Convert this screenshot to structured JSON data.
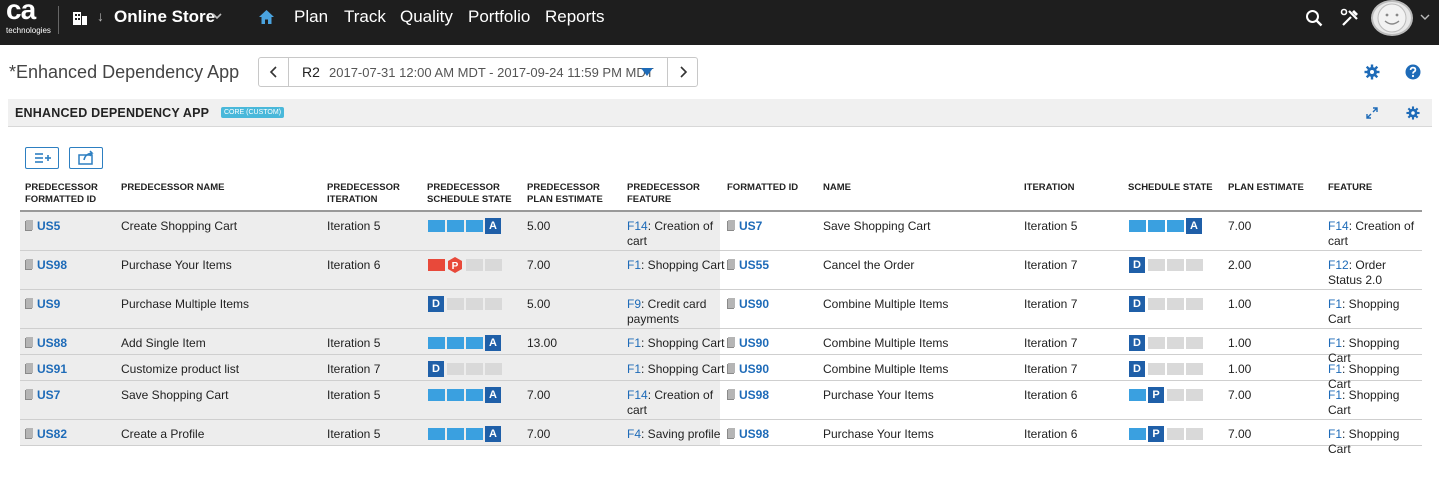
{
  "nav": {
    "logo_text": "ca",
    "logo_sub": "technologies",
    "workspace": "Online Store",
    "items": [
      "Plan",
      "Track",
      "Quality",
      "Portfolio",
      "Reports"
    ]
  },
  "app": {
    "title": "*Enhanced Dependency App",
    "release_name": "R2",
    "release_dates": "2017-07-31 12:00 AM MDT - 2017-09-24 11:59 PM MDT"
  },
  "panel": {
    "title": "ENHANCED DEPENDENCY APP",
    "badge": "CORE (CUSTOM)"
  },
  "columns": [
    [
      "PREDECESSOR",
      "FORMATTED ID"
    ],
    [
      "PREDECESSOR NAME"
    ],
    [
      "PREDECESSOR",
      "ITERATION"
    ],
    [
      "PREDECESSOR",
      "SCHEDULE STATE"
    ],
    [
      "PREDECESSOR",
      "PLAN ESTIMATE"
    ],
    [
      "PREDECESSOR",
      "FEATURE"
    ],
    [
      "FORMATTED ID"
    ],
    [
      "NAME"
    ],
    [
      "ITERATION"
    ],
    [
      "SCHEDULE STATE"
    ],
    [
      "PLAN ESTIMATE"
    ],
    [
      "FEATURE"
    ]
  ],
  "colors": {
    "accent": "#2d7fc1",
    "state_fill": "#3aa0e0",
    "state_empty": "#d9d9d9",
    "state_badge": "#1f5fa8",
    "blocked": "#e8493a"
  },
  "rows": [
    {
      "pred_id": "US5",
      "pred_name": "Create Shopping Cart",
      "pred_iter": "Iteration 5",
      "pred_state": "A",
      "pred_est": "5.00",
      "pred_feat_id": "F14",
      "pred_feat_name": ": Creation of cart",
      "id": "US7",
      "name": "Save Shopping Cart",
      "iter": "Iteration 5",
      "state": "A",
      "est": "7.00",
      "feat_id": "F14",
      "feat_name": ": Creation of cart"
    },
    {
      "pred_id": "US98",
      "pred_name": "Purchase Your Items",
      "pred_iter": "Iteration 6",
      "pred_state": "P-blocked",
      "pred_est": "7.00",
      "pred_feat_id": "F1",
      "pred_feat_name": ": Shopping Cart",
      "id": "US55",
      "name": "Cancel the Order",
      "iter": "Iteration 7",
      "state": "D",
      "est": "2.00",
      "feat_id": "F12",
      "feat_name": ": Order Status 2.0"
    },
    {
      "pred_id": "US9",
      "pred_name": "Purchase Multiple Items",
      "pred_iter": "",
      "pred_state": "D",
      "pred_est": "5.00",
      "pred_feat_id": "F9",
      "pred_feat_name": ": Credit card payments",
      "id": "US90",
      "name": "Combine Multiple Items",
      "iter": "Iteration 7",
      "state": "D",
      "est": "1.00",
      "feat_id": "F1",
      "feat_name": ": Shopping Cart"
    },
    {
      "pred_id": "US88",
      "pred_name": "Add Single Item",
      "pred_iter": "Iteration 5",
      "pred_state": "A",
      "pred_est": "13.00",
      "pred_feat_id": "F1",
      "pred_feat_name": ": Shopping Cart",
      "id": "US90",
      "name": "Combine Multiple Items",
      "iter": "Iteration 7",
      "state": "D",
      "est": "1.00",
      "feat_id": "F1",
      "feat_name": ": Shopping Cart"
    },
    {
      "pred_id": "US91",
      "pred_name": "Customize product list",
      "pred_iter": "Iteration 7",
      "pred_state": "D",
      "pred_est": "",
      "pred_feat_id": "F1",
      "pred_feat_name": ": Shopping Cart",
      "id": "US90",
      "name": "Combine Multiple Items",
      "iter": "Iteration 7",
      "state": "D",
      "est": "1.00",
      "feat_id": "F1",
      "feat_name": ": Shopping Cart"
    },
    {
      "pred_id": "US7",
      "pred_name": "Save Shopping Cart",
      "pred_iter": "Iteration 5",
      "pred_state": "A",
      "pred_est": "7.00",
      "pred_feat_id": "F14",
      "pred_feat_name": ": Creation of cart",
      "id": "US98",
      "name": "Purchase Your Items",
      "iter": "Iteration 6",
      "state": "P",
      "est": "7.00",
      "feat_id": "F1",
      "feat_name": ": Shopping Cart"
    },
    {
      "pred_id": "US82",
      "pred_name": "Create a Profile",
      "pred_iter": "Iteration 5",
      "pred_state": "A",
      "pred_est": "7.00",
      "pred_feat_id": "F4",
      "pred_feat_name": ": Saving profile",
      "id": "US98",
      "name": "Purchase Your Items",
      "iter": "Iteration 6",
      "state": "P",
      "est": "7.00",
      "feat_id": "F1",
      "feat_name": ": Shopping Cart"
    }
  ]
}
